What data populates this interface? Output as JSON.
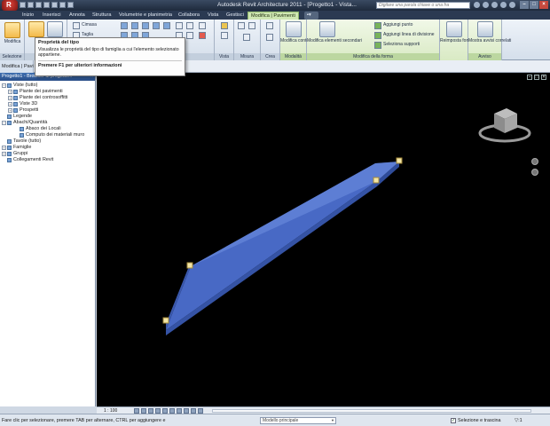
{
  "titlebar": {
    "app_logo": "R",
    "title": "Autodesk Revit Architecture 2011 - [Progetto1 - Vista...",
    "search_placeholder": "Digitare una parola chiave o una fra"
  },
  "tabs": [
    {
      "label": "Inizio"
    },
    {
      "label": "Inserisci"
    },
    {
      "label": "Annota"
    },
    {
      "label": "Struttura"
    },
    {
      "label": "Volumetrie e planimetria"
    },
    {
      "label": "Collabora"
    },
    {
      "label": "Vista"
    },
    {
      "label": "Gestisci"
    },
    {
      "label": "Modifica | Pavimenti",
      "active": true
    }
  ],
  "ribbon": {
    "modify_label": "Modifica",
    "cut_label": "Cimasa",
    "copy_label": "Taglia",
    "modify_panel_label": "Modifica",
    "view_panel_label": "Vista",
    "measure_panel_label": "Misura",
    "create_panel_label": "Crea",
    "edit_boundary_label": "Modifica contorno",
    "mode_panel_label": "Modalità",
    "edit_sub_label": "Modifica elementi secondari",
    "add_point_label": "Aggiungi punto",
    "add_split_label": "Aggiungi linea di divisione",
    "pick_supports_label": "Seleziona supporti",
    "shape_panel_label": "Modifica della forma",
    "reset_shape_label": "Reimposta forma",
    "warnings_label": "Mostra avvisi correlati",
    "warning_panel_label": "Avviso",
    "select_panel_label": "Selezione",
    "props_panel_label": "Prop"
  },
  "optionsbar": {
    "selection_text": "Modifica | Pavi"
  },
  "tooltip": {
    "title": "Proprietà del tipo",
    "description": "Visualizza le proprietà del tipo di famiglia a cui l'elemento selezionato appartiene.",
    "help": "Premere F1 per ulteriori informazioni"
  },
  "browser": {
    "title": "Progetto1 - Browser di progetto...",
    "items": [
      {
        "label": "Viste (tutto)",
        "level": 0,
        "exp": "−"
      },
      {
        "label": "Piante dei pavimenti",
        "level": 1,
        "exp": "+"
      },
      {
        "label": "Piante dei controsoffitti",
        "level": 1,
        "exp": "+"
      },
      {
        "label": "Viste 3D",
        "level": 1,
        "exp": "+"
      },
      {
        "label": "Prospetti",
        "level": 1,
        "exp": "+"
      },
      {
        "label": "Legende",
        "level": 0,
        "exp": ""
      },
      {
        "label": "Abachi/Quantità",
        "level": 0,
        "exp": "−"
      },
      {
        "label": "Abaco dei Locali",
        "level": 2,
        "exp": ""
      },
      {
        "label": "Computo dei materiali muro",
        "level": 2,
        "exp": ""
      },
      {
        "label": "Tavole (tutto)",
        "level": 0,
        "exp": ""
      },
      {
        "label": "Famiglie",
        "level": 0,
        "exp": "+"
      },
      {
        "label": "Gruppi",
        "level": 0,
        "exp": "+"
      },
      {
        "label": "Collegamenti Revit",
        "level": 0,
        "exp": ""
      }
    ]
  },
  "viewbar": {
    "scale": "1 : 100"
  },
  "statusbar": {
    "hint": "Fare clic per selezionare, premere TAB per alternare, CTRL per aggiungere e",
    "model": "Modello principale",
    "drag_label": "Selezione e trascina",
    "filter": "▽:1"
  },
  "colors": {
    "floor_top": "#6f8fe0",
    "floor_side": "#3d5fb5",
    "active_tab": "#cfe7b3"
  }
}
